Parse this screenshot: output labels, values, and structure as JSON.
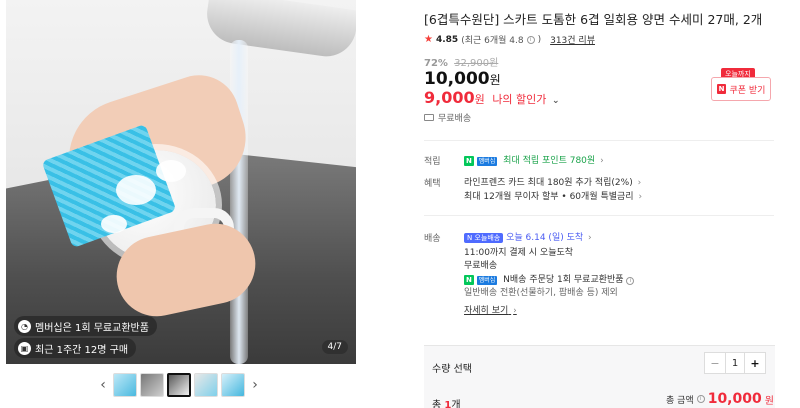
{
  "gallery": {
    "badges": [
      "멤버십은 1회 무료교환반품",
      "최근 1주간 12명 구매"
    ],
    "page_counter": "4/7",
    "prev_label": "‹",
    "next_label": "›"
  },
  "product": {
    "title": "[6겹특수원단] 스카트 도톰한 6겹 일회용 양면 수세미 27매, 2개",
    "rating": "4.85",
    "rating_note": "(최근 6개월 4.8",
    "reviews": "313건 리뷰",
    "discount_pct": "72%",
    "original_price": "32,900원",
    "price": "10,000",
    "price_unit": "원",
    "my_price": "9,000",
    "my_price_unit": "원",
    "my_price_label": "나의 할인가",
    "shipping_mini": "무료배송"
  },
  "coupon": {
    "tag": "오늘까지",
    "logo": "N",
    "label": "쿠폰 받기"
  },
  "points": {
    "label": "적립",
    "npay": "N",
    "membership": "멤버십",
    "text": "최대 적립 포인트 780원"
  },
  "benefit": {
    "label": "혜택",
    "line1": "라인프렌즈 카드 최대 180원 추가 적립(2%)",
    "line2": "최대 12개월 무이자 할부 • 60개월 특별금리"
  },
  "delivery": {
    "label": "배송",
    "today_logo": "N 오늘배송",
    "date": "오늘 6.14 (일) 도착",
    "line1": "11:00까지 결제 시 오늘도착",
    "line2": "무료배송",
    "npay": "N",
    "membership": "멤버십",
    "line3": "N배송 주문당 1회 무료교환반품",
    "line4": "일반배송 전환(선물하기, 팝배송 등) 제외",
    "more": "자세히 보기"
  },
  "quantity": {
    "label": "수량 선택",
    "value": "1",
    "minus": "−",
    "plus": "+"
  },
  "total": {
    "count_prefix": "총",
    "count": "1",
    "count_suffix": "개",
    "label": "총 금액",
    "amount": "10,000",
    "unit": "원"
  },
  "colors": {
    "accent_red": "#f02b3b",
    "npay_green": "#03c75a",
    "today_blue": "#4f6bff"
  }
}
